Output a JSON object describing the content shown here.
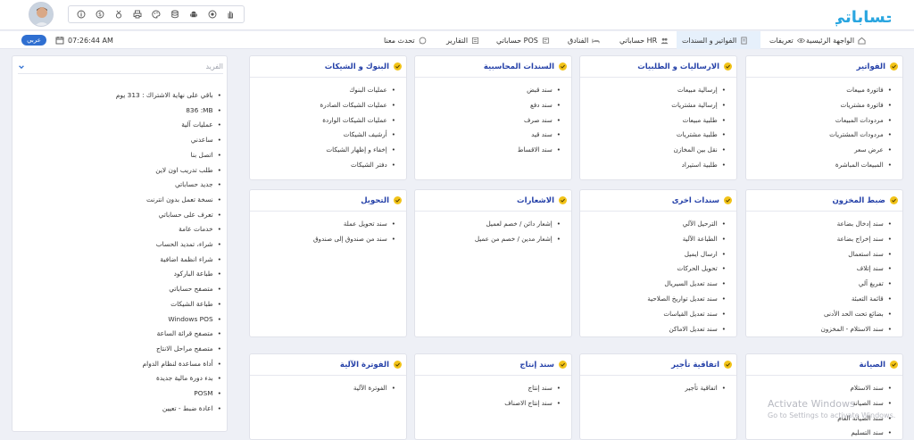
{
  "header": {
    "logo_text": "حساباتي",
    "tool_icons": [
      "info-icon",
      "money-icon",
      "medal-icon",
      "printer-icon",
      "palette-icon",
      "database-icon",
      "android-icon",
      "record-icon",
      "hand-icon"
    ]
  },
  "nav": {
    "tabs": [
      {
        "label": "الواجهة الرئيسية",
        "icon": "home-icon"
      },
      {
        "label": "تعريفات",
        "icon": "eye-icon"
      },
      {
        "label": "الفواتير و السندات",
        "icon": "invoice-icon"
      },
      {
        "label": "حساباتي HR",
        "icon": "users-icon"
      },
      {
        "label": "الفنادق",
        "icon": "hotel-icon"
      },
      {
        "label": "حساباتي POS",
        "icon": "pos-icon"
      },
      {
        "label": "التقارير",
        "icon": "report-icon"
      },
      {
        "label": "تحدث معنا",
        "icon": "chat-icon"
      }
    ],
    "time": "07:26:44 AM",
    "lang_button": "عربي"
  },
  "sidebar": {
    "search_placeholder": "الفريد",
    "items": [
      "باقي على نهاية الاشتراك : 313 يوم",
      "836 :MB",
      "عمليات آلية",
      "ساعدني",
      "اتصل بنا",
      "طلب تدريب اون لاين",
      "جديد حساباتي",
      "نسخة تعمل بدون انترنت",
      "تعرف على حساباتي",
      "خدمات عامة",
      "شراء، تمديد الحساب",
      "شراء انظمة اضافية",
      "طباعة الباركود",
      "متصفح حساباتي",
      "طباعة الشيكات",
      "Windows POS",
      "متصفح قرائة الساعة",
      "متصفح مراحل الانتاج",
      "أداة مساعدة لنظام الدوام",
      "بدء دورة مالية جديدة",
      "POSM",
      "اعادة ضبط - تعيين"
    ]
  },
  "cards": {
    "invoices": {
      "title": "الفواتير",
      "items": [
        "فاتورة مبيعات",
        "فاتورة مشتريات",
        "مردودات المبيعات",
        "مردودات المشتريات",
        "عرض سعر",
        "المبيعات المباشرة"
      ]
    },
    "shipments": {
      "title": "الارساليات و الطلبيات",
      "items": [
        "إرسالية مبيعات",
        "إرسالية مشتريات",
        "طلبية مبيعات",
        "طلبية مشتريات",
        "نقل بين المخازن",
        "طلبية استيراد"
      ]
    },
    "vouchers": {
      "title": "السندات المحاسبية",
      "items": [
        "سند قبض",
        "سند دفع",
        "سند صرف",
        "سند قيد",
        "سند الاقساط"
      ]
    },
    "banks": {
      "title": "البنوك و الشيكات",
      "items": [
        "عمليات البنوك",
        "عمليات الشيكات الصادرة",
        "عمليات الشيكات الواردة",
        "أرشيف الشيكات",
        "إخفاء و إظهار الشيكات",
        "دفتر الشيكات"
      ]
    },
    "inventory": {
      "title": "ضبط المخزون",
      "items": [
        "سند إدخال بضاعة",
        "سند إخراج بضاعة",
        "سند استعمال",
        "سند إتلاف",
        "تفريغ آلي",
        "قائمة التعبئة",
        "بضائع تحت الحد الأدنى",
        "سند الاستلام - المخزون"
      ]
    },
    "other_vouchers": {
      "title": "سندات اخرى",
      "items": [
        "الترحيل الآلي",
        "الطباعة الآلية",
        "ارسال ايميل",
        "تحويل الحركات",
        "سند تعديل السيريال",
        "سند تعديل تواريخ الصلاحية",
        "سند تعديل القياسات",
        "سند تعديل الاماكن"
      ]
    },
    "notices": {
      "title": "الاشعارات",
      "items": [
        "إشعار دائن / خصم لعميل",
        "إشعار مدين / خصم من عميل"
      ]
    },
    "transfer": {
      "title": "التحويل",
      "items": [
        "سند تحويل عملة",
        "سند من صندوق إلى صندوق"
      ]
    },
    "maintenance": {
      "title": "الصيانة",
      "items": [
        "سند الاستلام",
        "سند الصيانة",
        "سند الصيانة العام",
        "سند التسليم"
      ]
    },
    "rental": {
      "title": "اتفاقية تأجير",
      "items": [
        "اتفاقية تأجير"
      ]
    },
    "production": {
      "title": "سند إنتاج",
      "items": [
        "سند إنتاج",
        "سند إنتاج الاصناف"
      ]
    },
    "auto_invoice": {
      "title": "الفوترة الآلية",
      "items": [
        "الفوترة الآلية"
      ]
    }
  },
  "watermark": {
    "line1": "Activate Windows",
    "line2": "Go to Settings to activate Windows."
  },
  "colors": {
    "accent": "#2f6fd1",
    "title": "#2440a8",
    "check": "#f2c318",
    "active_tab": "#e6f0fb"
  }
}
